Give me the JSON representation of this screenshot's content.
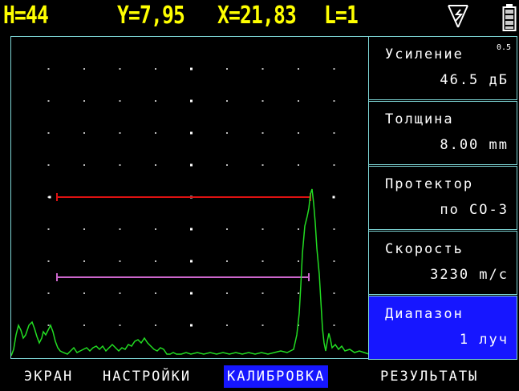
{
  "status": {
    "h": "H=44",
    "y": "Y=7,95",
    "x": "X=21,83",
    "l": "L=1"
  },
  "icons": {
    "probe": "probe-icon",
    "battery": "battery-icon"
  },
  "colors": {
    "readout": "#ffff00",
    "frame": "#7fd8d8",
    "signal": "#22dd22",
    "gate_a": "#dd1111",
    "gate_b": "#cc66cc",
    "highlight": "#1616ff"
  },
  "params": [
    {
      "label": "Усиление",
      "value": "46.5 дБ",
      "badge": "0.5",
      "active": false
    },
    {
      "label": "Толщина",
      "value": "8.00 mm",
      "badge": "",
      "active": false
    },
    {
      "label": "Протектор",
      "value": "по CO-3",
      "badge": "",
      "active": false
    },
    {
      "label": "Скорость",
      "value": "3230 m/c",
      "badge": "",
      "active": false
    },
    {
      "label": "Диапазон",
      "value": "1 луч",
      "badge": "",
      "active": true
    }
  ],
  "menu": [
    {
      "label": "ЭКРАН",
      "active": false
    },
    {
      "label": "НАСТРОЙКИ",
      "active": false
    },
    {
      "label": "КАЛИБРОВКА",
      "active": true
    },
    {
      "label": "РЕЗУЛЬТАТЫ",
      "active": false
    }
  ]
}
